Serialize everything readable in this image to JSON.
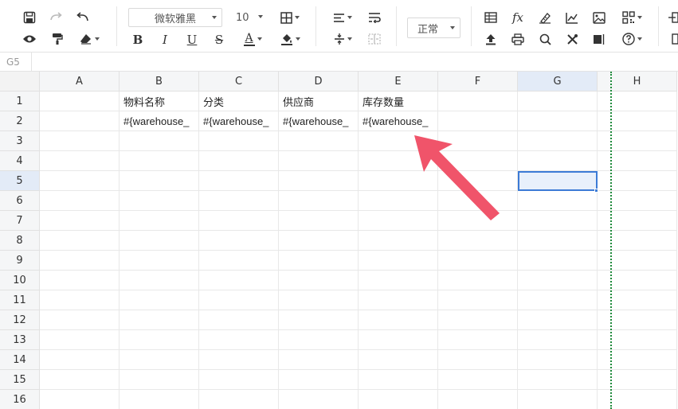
{
  "toolbar": {
    "font_name": "微软雅黑",
    "font_size": "10",
    "number_format": "正常",
    "icons": {
      "row1": [
        "save-icon",
        "redo-icon",
        "undo-icon",
        "merge-cells-icon",
        "align-left-icon",
        "wrap-text-icon",
        "table-icon",
        "function-icon",
        "clear-format-icon",
        "chart-icon",
        "image-icon",
        "qrcode-icon"
      ],
      "row2": [
        "preview-icon",
        "format-painter-icon",
        "eraser-icon",
        "bold-icon",
        "italic-icon",
        "underline-icon",
        "strikethrough-icon",
        "font-color-icon",
        "fill-color-icon",
        "vertical-align-icon",
        "merge-icon",
        "upload-icon",
        "print-icon",
        "search-icon",
        "tools-icon",
        "freeze-icon",
        "help-icon"
      ]
    },
    "bold_label": "B",
    "italic_label": "I",
    "underline_label": "U",
    "strike_label": "S",
    "fontcolor_label": "A",
    "fx_label": "fx",
    "font_color": "#d32f2f"
  },
  "formula_bar": {
    "cell_ref": "G5"
  },
  "sheet": {
    "columns": [
      "A",
      "B",
      "C",
      "D",
      "E",
      "F",
      "G",
      "H"
    ],
    "active_column": "G",
    "active_row": "5",
    "rows": [
      "1",
      "2",
      "3",
      "4",
      "5",
      "6",
      "7",
      "8",
      "9",
      "10",
      "11",
      "12",
      "13",
      "14",
      "15",
      "16"
    ],
    "cells": {
      "B1": "物料名称",
      "C1": "分类",
      "D1": "供应商",
      "E1": "库存数量",
      "B2": "#{warehouse_",
      "C2": "#{warehouse_",
      "D2": "#{warehouse_",
      "E2": "#{warehouse_"
    },
    "selection_color": "#3c7bd6",
    "print_boundary_color": "#1e8a3a",
    "arrow_color": "#f0546a"
  }
}
